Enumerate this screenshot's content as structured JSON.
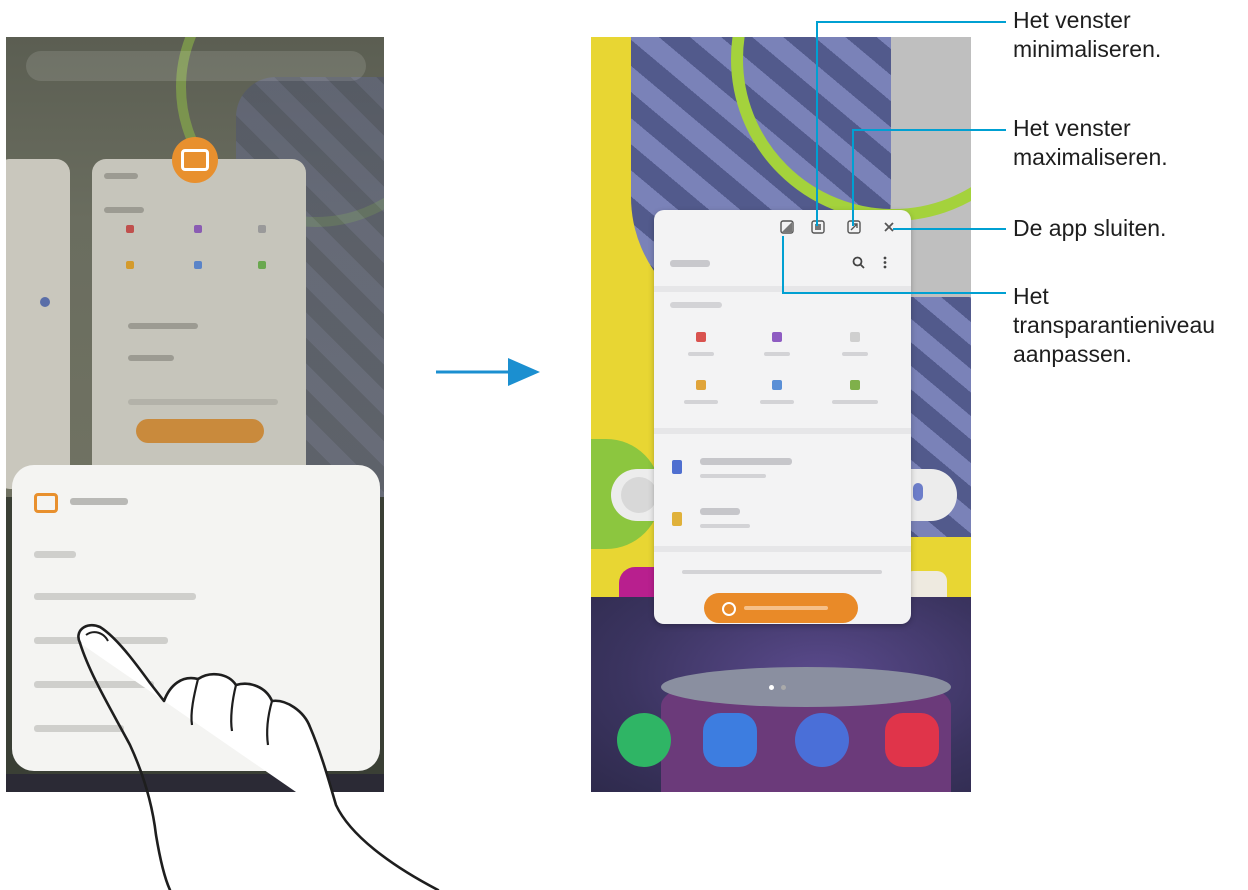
{
  "callouts": {
    "minimize": {
      "line1": "Het venster",
      "line2": "minimaliseren."
    },
    "maximize": {
      "line1": "Het venster",
      "line2": "maximaliseren."
    },
    "close": {
      "line1": "De app sluiten."
    },
    "transparency": {
      "line1": "Het",
      "line2": "transparantieniveau",
      "line3": "aanpassen."
    }
  },
  "colors": {
    "callout_line": "#00a0d2",
    "arrow": "#1b8fd0",
    "app_accent": "#e8902e",
    "popup_bg": "#f3f3f4"
  },
  "icons": {
    "popup_controls": [
      "transparency-icon",
      "minimize-icon",
      "maximize-icon",
      "close-icon"
    ],
    "popup_toolbar": [
      "search-icon",
      "more-options-icon"
    ],
    "dock": [
      "phone-icon",
      "messages-icon",
      "internet-icon",
      "camera-icon"
    ]
  }
}
